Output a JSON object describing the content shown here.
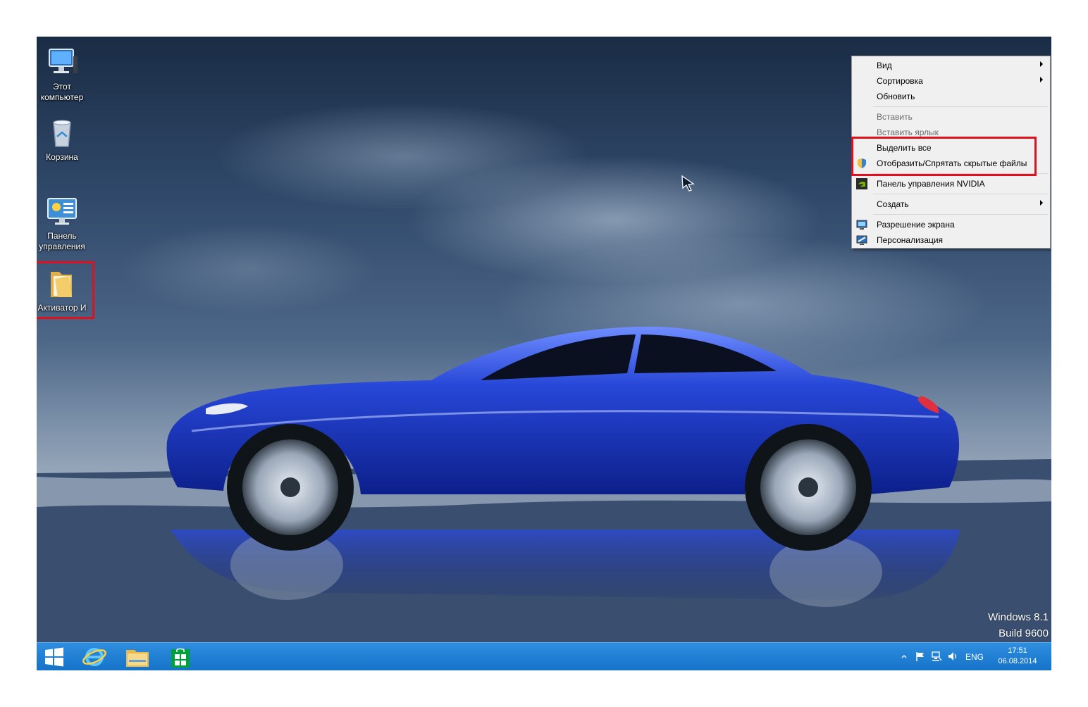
{
  "desktop_icons": [
    {
      "label": "Этот компьютер",
      "icon": "computer-icon"
    },
    {
      "label": "Корзина",
      "icon": "recycle-bin-icon"
    },
    {
      "label": "Панель управления",
      "icon": "control-panel-icon"
    },
    {
      "label": "Активатор И",
      "icon": "folder-icon"
    }
  ],
  "context_menu": {
    "items": [
      {
        "label": "Вид",
        "submenu": true
      },
      {
        "label": "Сортировка",
        "submenu": true
      },
      {
        "label": "Обновить"
      },
      {
        "label": "Вставить",
        "disabled": true
      },
      {
        "label": "Вставить ярлык",
        "disabled": true
      },
      {
        "label": "Выделить все"
      },
      {
        "label": "Отобразить/Спрятать скрытые файлы",
        "icon": "shield-icon"
      },
      {
        "label": "Панель управления NVIDIA",
        "icon": "nvidia-icon"
      },
      {
        "label": "Создать",
        "submenu": true
      },
      {
        "label": "Разрешение экрана",
        "icon": "display-icon"
      },
      {
        "label": "Персонализация",
        "icon": "personalize-icon"
      }
    ]
  },
  "watermark": {
    "line1": "Windows 8.1",
    "line2": "Build 9600"
  },
  "taskbar": {
    "apps": [
      "start-icon",
      "ie-icon",
      "explorer-icon",
      "store-icon"
    ],
    "tray": {
      "language": "ENG",
      "time": "17:51",
      "date": "06.08.2014"
    }
  },
  "colors": {
    "highlight": "#e0101e",
    "taskbar": "#1673c8",
    "car": "#1f3fd0"
  }
}
